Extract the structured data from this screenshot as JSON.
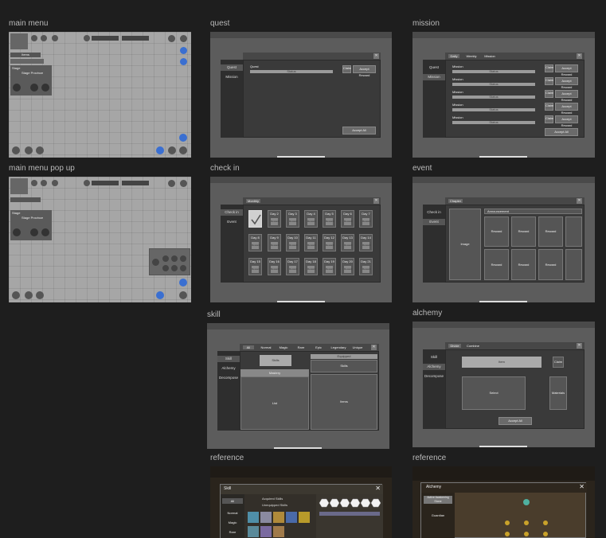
{
  "labels": {
    "main_menu": "main menu",
    "quest": "quest",
    "mission": "mission",
    "main_menu_popup": "main menu pop up",
    "check_in": "check in",
    "event": "event",
    "skill": "skill",
    "alchemy": "alchemy",
    "reference1": "reference",
    "reference2": "reference"
  },
  "main_menu": {
    "stage_label": "Stage",
    "stage_value": "Stage Province",
    "items": "Items"
  },
  "quest": {
    "side_items": [
      "Quest",
      "Mission"
    ],
    "row_label": "Quest",
    "bar_text": "Status",
    "claim_label": "Claim",
    "accept_reward": "Accept Reward",
    "accept_all": "Accept All"
  },
  "mission": {
    "tabs": [
      "Daily",
      "Weekly",
      "Mission"
    ],
    "side_items": [
      "Quest",
      "Mission"
    ],
    "rows": [
      "Mission",
      "Mission",
      "Mission",
      "Mission",
      "Mission"
    ],
    "bar_text": "Status",
    "claim_label": "Claim",
    "accept_reward": "Accept Reward",
    "accept_all": "Accept All"
  },
  "check_in": {
    "title": "Monthly",
    "side_items": [
      "Check in",
      "Event"
    ],
    "days": [
      "Day 2",
      "Day 3",
      "Day 4",
      "Day 5",
      "Day 6",
      "Day 7",
      "Day 8",
      "Day 9",
      "Day 10",
      "Day 11",
      "Day 12",
      "Day 13",
      "Day 14",
      "Day 15",
      "Day 16",
      "Day 17",
      "Day 18",
      "Day 19",
      "Day 20",
      "Day 21"
    ],
    "cell_sub": "Reward"
  },
  "event": {
    "title": "Chapter",
    "side_items": [
      "Check in",
      "Event"
    ],
    "announcement": "Announcement",
    "image": "Image",
    "reward": "Reward"
  },
  "skill": {
    "tabs": [
      "All",
      "Normal",
      "Magic",
      "Rare",
      "Epic",
      "Legendary",
      "Unique"
    ],
    "side_items": [
      "Skill",
      "Alchemy",
      "Decompose"
    ],
    "skills": "Skills",
    "mastery": "Mastery",
    "list": "List",
    "items": "Items",
    "equipped": "Equipped"
  },
  "alchemy": {
    "tabs": [
      "Divide",
      "Combine"
    ],
    "side_items": [
      "Skill",
      "Alchemy",
      "Decompose"
    ],
    "item": "Item",
    "claim": "Claim",
    "select": "Select",
    "materials": "Materials",
    "accept_all": "Accept All"
  },
  "reference1": {
    "title": "Skill",
    "side_items": [
      "All",
      "Normal",
      "Magic",
      "Rare"
    ],
    "acquired": "Acquired Skills",
    "equipped": "Unequipped Skills"
  },
  "reference2": {
    "title": "Alchemy",
    "side_items": [
      "Active Awakening Stone",
      "Guardian"
    ]
  },
  "colors": {
    "background": "#1e1e1e",
    "wire_light": "#a6a6a6",
    "wire_dark": "#5c5c5c",
    "accent_blue": "#3a6fd1"
  }
}
